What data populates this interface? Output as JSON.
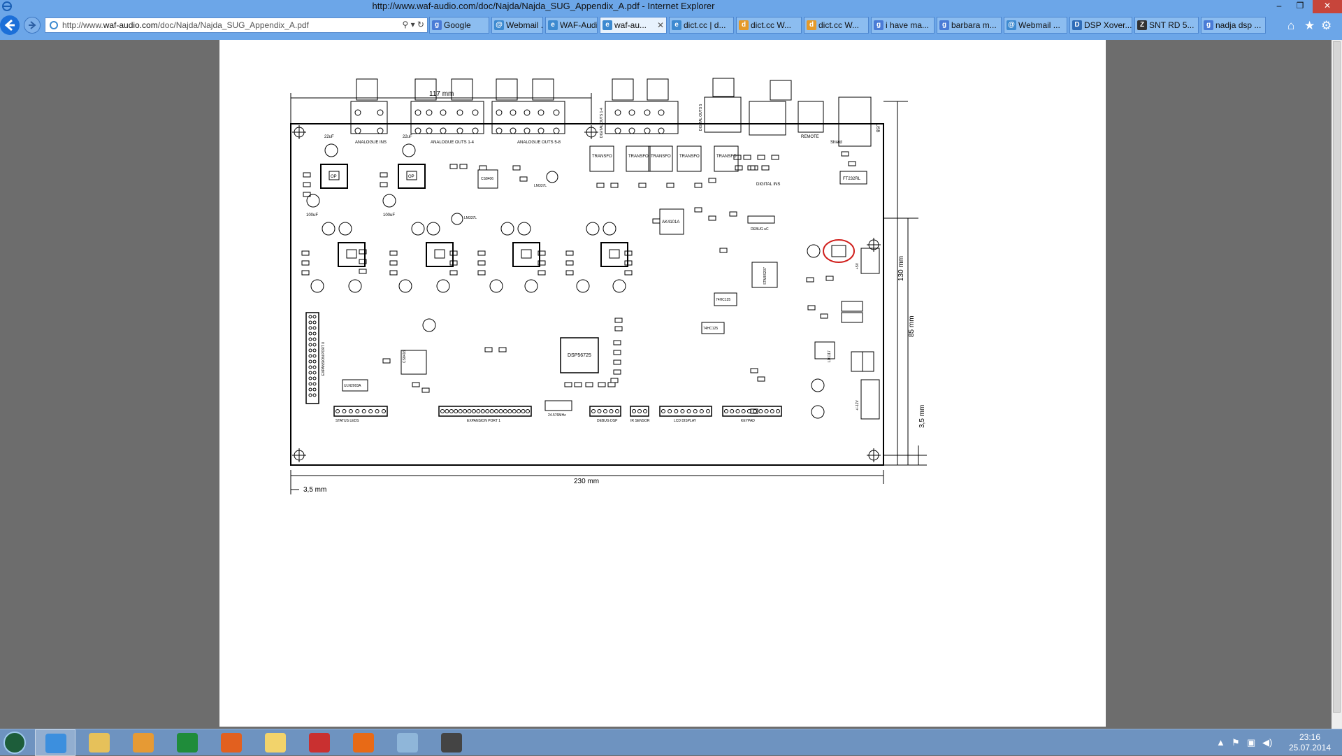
{
  "window": {
    "title": "http://www.waf-audio.com/doc/Najda/Najda_SUG_Appendix_A.pdf - Internet Explorer"
  },
  "address_bar": {
    "url_prefix": "http://www.",
    "url_domain": "waf-audio.com",
    "url_rest": "/doc/Najda/Najda_SUG_Appendix_A.pdf",
    "tools": "⚲ ▾ ↻"
  },
  "tabs": [
    {
      "label": "Google",
      "icon_text": "g",
      "icon_color": "#4a7bd6",
      "active": false
    },
    {
      "label": "Webmail ...",
      "icon_text": "@",
      "icon_color": "#3d8ad0",
      "active": false
    },
    {
      "label": "WAF-Audio",
      "icon_text": "e",
      "icon_color": "#3d8ad0",
      "active": false
    },
    {
      "label": "waf-au...",
      "icon_text": "e",
      "icon_color": "#3d8ad0",
      "active": true
    },
    {
      "label": "dict.cc | d...",
      "icon_text": "e",
      "icon_color": "#3d8ad0",
      "active": false
    },
    {
      "label": "dict.cc W...",
      "icon_text": "d",
      "icon_color": "#e59a2a",
      "active": false
    },
    {
      "label": "dict.cc W...",
      "icon_text": "d",
      "icon_color": "#e59a2a",
      "active": false
    },
    {
      "label": "i have ma...",
      "icon_text": "g",
      "icon_color": "#4a7bd6",
      "active": false
    },
    {
      "label": "barbara m...",
      "icon_text": "g",
      "icon_color": "#4a7bd6",
      "active": false
    },
    {
      "label": "Webmail ...",
      "icon_text": "@",
      "icon_color": "#3d8ad0",
      "active": false
    },
    {
      "label": "DSP Xover...",
      "icon_text": "D",
      "icon_color": "#2f6cb7",
      "active": false
    },
    {
      "label": "SNT RD 5...",
      "icon_text": "Z",
      "icon_color": "#333333",
      "active": false
    },
    {
      "label": "nadja dsp ...",
      "icon_text": "g",
      "icon_color": "#4a7bd6",
      "active": false
    }
  ],
  "tab_close": "✕",
  "window_buttons": {
    "minimize": "–",
    "restore": "❐",
    "close": "✕"
  },
  "toolbar_icons": {
    "home": "⌂",
    "favorites": "★",
    "settings": "⚙"
  },
  "schematic": {
    "dimensions": {
      "top_width": "117 mm",
      "bottom_width": "230 mm",
      "left_offset": "3,5 mm",
      "height_total": "130 mm",
      "height_partial": "85 mm",
      "bottom_offset": "3,5 mm"
    },
    "connector_labels": {
      "analogue_ins": "ANALOGUE INS",
      "analogue_outs_1_4": "ANALOGUE OUTS 1-4",
      "analogue_outs_5_8": "ANALOGUE OUTS 5-8",
      "digital_outs_1_4": "DIGITAL OUTS 1-4",
      "digital_outs_5": "DIGITAL OUTS 5",
      "digital_ins": "DIGITAL INS",
      "remote": "REMOTE",
      "usb": "USB",
      "shield": "Shield"
    },
    "transformers": [
      "TRANSFO",
      "TRANSFO",
      "TRANSFO",
      "TRANSFO",
      "TRANSFO"
    ],
    "chips": {
      "dsp": "DSP56725",
      "ak": "AK4101A",
      "ft": "FT232RL",
      "stm": "STM8S207",
      "lm1": "LM337L",
      "lm2": "LM337L",
      "hc1": "74HC125",
      "hc2": "74HC125",
      "cs": "CS8416",
      "cs2": "CS8406",
      "uln": "ULN2003A",
      "lm317": "LD1117",
      "op": "OP"
    },
    "component_values": {
      "cap22": "22uF",
      "cap100": "100uF"
    },
    "expansion_port_0": "EXPANSION PORT 0",
    "bottom_labels": {
      "status_leds": "STATUS LEDS",
      "expansion_port_1": "EXPANSION PORT 1",
      "crystal": "24.576MHz",
      "debug_dsp": "DEBUG DSP",
      "ir_sensor": "IR SENSOR",
      "lcd_display": "LCD DISPLAY",
      "keypad": "KEYPAD",
      "debug_uc": "DEBUG uC",
      "plus5v": "+5V",
      "plusminus12v": "+/-12V"
    }
  },
  "taskbar": {
    "items": [
      {
        "name": "internet-explorer",
        "color": "#3c8fde"
      },
      {
        "name": "file-explorer",
        "color": "#e6c15a"
      },
      {
        "name": "media-player",
        "color": "#e69a34"
      },
      {
        "name": "excel",
        "color": "#1f8c3a"
      },
      {
        "name": "firefox",
        "color": "#e2601f"
      },
      {
        "name": "folder",
        "color": "#f2d36b"
      },
      {
        "name": "app-swirl",
        "color": "#c93030"
      },
      {
        "name": "app-k1",
        "color": "#e86a16"
      },
      {
        "name": "paint",
        "color": "#8fb6d9"
      },
      {
        "name": "app-satellite",
        "color": "#444444"
      }
    ],
    "time": "23:16",
    "date": "25.07.2014"
  }
}
